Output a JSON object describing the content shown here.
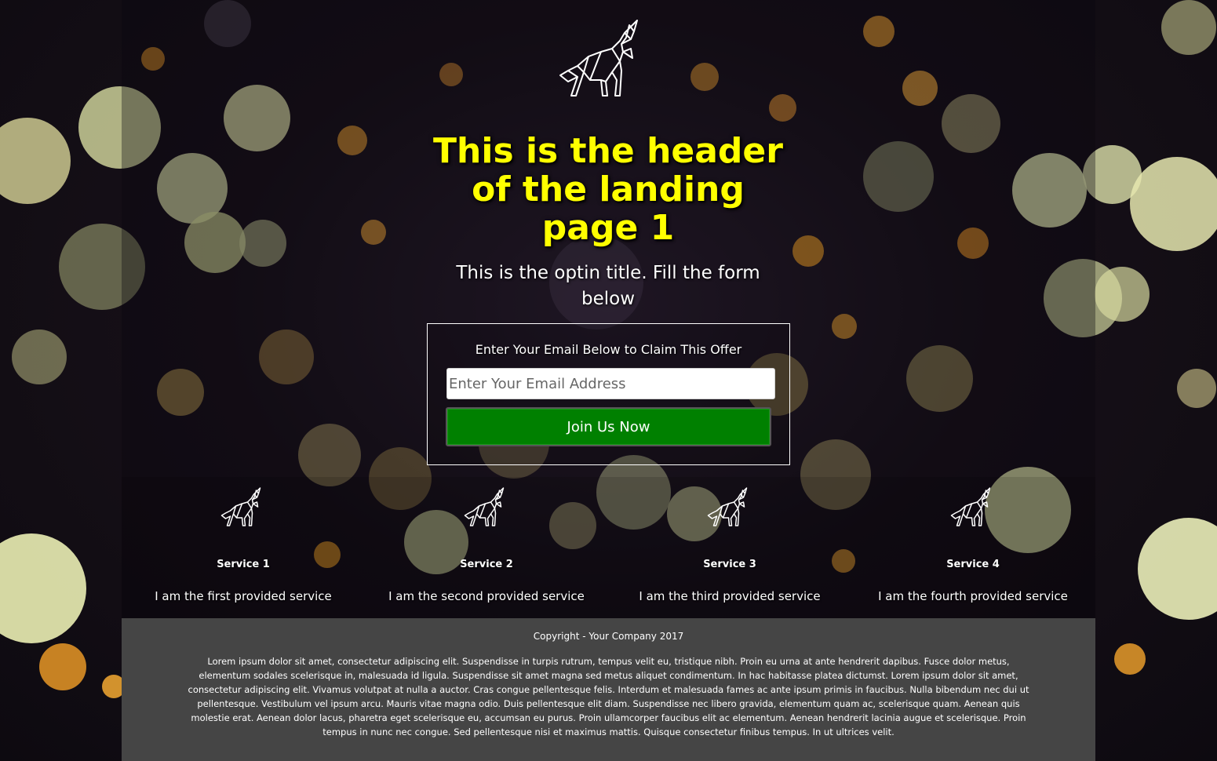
{
  "header": {
    "logo_icon": "wolf-logo-icon",
    "title": "This is the header of the landing page 1"
  },
  "optin": {
    "title": "This is the optin title. Fill the form below"
  },
  "form": {
    "label": "Enter Your Email Below to Claim This Offer",
    "email_placeholder": "Enter Your Email Address",
    "email_value": "",
    "submit_label": "Join Us Now"
  },
  "services": [
    {
      "icon": "wolf-icon",
      "title": "Service 1",
      "description": "I am the first provided service"
    },
    {
      "icon": "wolf-icon",
      "title": "Service 2",
      "description": "I am the second provided service"
    },
    {
      "icon": "wolf-icon",
      "title": "Service 3",
      "description": "I am the third provided service"
    },
    {
      "icon": "wolf-icon",
      "title": "Service 4",
      "description": "I am the fourth provided service"
    }
  ],
  "footer": {
    "copyright": "Copyright - Your Company 2017",
    "body": "Lorem ipsum dolor sit amet, consectetur adipiscing elit. Suspendisse in turpis rutrum, tempus velit eu, tristique nibh. Proin eu urna at ante hendrerit dapibus. Fusce dolor metus, elementum sodales scelerisque in, malesuada id ligula. Suspendisse sit amet magna sed metus aliquet condimentum. In hac habitasse platea dictumst. Lorem ipsum dolor sit amet, consectetur adipiscing elit. Vivamus volutpat at nulla a auctor. Cras congue pellentesque felis. Interdum et malesuada fames ac ante ipsum primis in faucibus. Nulla bibendum nec dui ut pellentesque. Vestibulum vel ipsum arcu. Mauris vitae magna odio. Duis pellentesque elit diam. Suspendisse nec libero gravida, elementum quam ac, scelerisque quam. Aenean quis molestie erat. Aenean dolor lacus, pharetra eget scelerisque eu, accumsan eu purus. Proin ullamcorper faucibus elit ac elementum. Aenean hendrerit lacinia augue et scelerisque. Proin tempus in nunc nec congue. Sed pellentesque nisi et maximus mattis. Quisque consectetur finibus tempus. In ut ultrices velit."
  },
  "colors": {
    "headline": "#ffff00",
    "button": "#008000",
    "footer_bg": "#454545",
    "bokeh_light": "#e6e3a8",
    "bokeh_orange": "#f0a020"
  }
}
